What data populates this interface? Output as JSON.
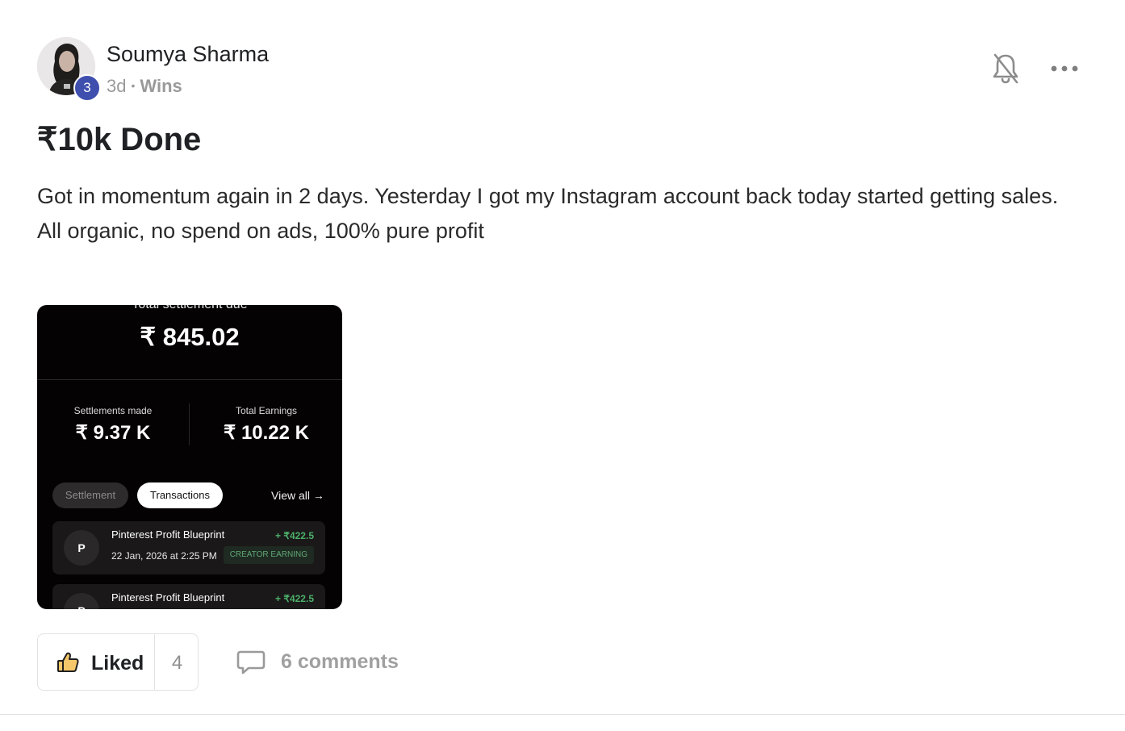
{
  "author": {
    "name": "Soumya Sharma",
    "level": "3",
    "time_ago": "3d",
    "separator": "•",
    "category": "Wins"
  },
  "post": {
    "title": "₹10k Done",
    "body_line1": "Got in momentum again in 2 days. Yesterday I got my Instagram account back today started getting sales.",
    "body_line2": "All organic, no spend on ads, 100% pure profit"
  },
  "attachment": {
    "due_label": "Total settlement due",
    "due_amount": "₹ 845.02",
    "settlements_label": "Settlements made",
    "settlements_value": "₹ 9.37 K",
    "earnings_label": "Total Earnings",
    "earnings_value": "₹ 10.22 K",
    "tab_settlement": "Settlement",
    "tab_transactions": "Transactions",
    "view_all": "View all →",
    "transactions": [
      {
        "avatar": "P",
        "title": "Pinterest Profit Blueprint",
        "amount": "+ ₹422.5",
        "date": "22 Jan, 2026 at 2:25 PM",
        "tag": "CREATOR EARNING"
      },
      {
        "avatar": "P",
        "title": "Pinterest Profit Blueprint",
        "amount": "+ ₹422.5"
      }
    ]
  },
  "actions": {
    "like_label": "Liked",
    "like_count": "4",
    "comments_label": "6 comments"
  },
  "icons": {
    "bell": "bell-off-icon",
    "more": "more-horizontal-icon",
    "like": "thumbs-up-icon",
    "comment": "comment-icon"
  },
  "colors": {
    "level_badge": "#3f4fae",
    "positive_amount": "#4caf6a"
  }
}
